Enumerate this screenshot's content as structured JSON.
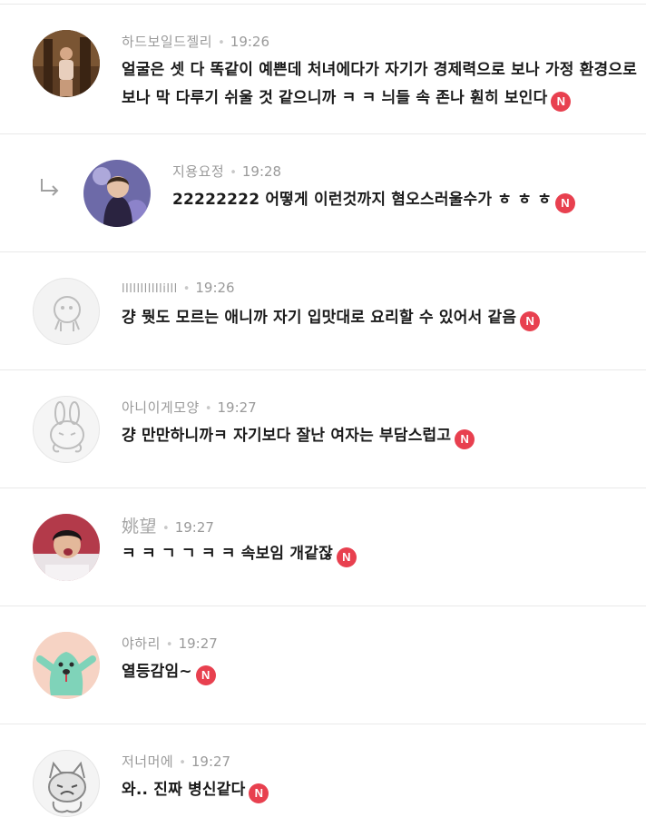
{
  "comments": [
    {
      "nickname": "하드보일드젤리",
      "time": "19:26",
      "text_line1": "얼굴은 셋 다 똑같이 예쁜데 처녀에다가 자기가 경제력으로 보나 가정 환경으로",
      "text_line2": "보나 막 다루기 쉬울 것 같으니까 ㅋ ㅋ 늬들 속 존나 훤히 보인다",
      "badge": "N",
      "avatar": "photo-avatar"
    },
    {
      "nickname": "지용요정",
      "time": "19:28",
      "text_line1": "22222222 어떻게 이런것까지 혐오스러울수가 ㅎ ㅎ ㅎ",
      "badge": "N",
      "avatar": "photo-avatar",
      "is_reply": true
    },
    {
      "nickname": "lllllllllllilll",
      "time": "19:26",
      "text_line1": "걍 뭣도 모르는 애니까 자기 입맛대로 요리할 수 있어서 같음",
      "badge": "N",
      "avatar": "default-character-avatar"
    },
    {
      "nickname": "아니이게모양",
      "time": "19:27",
      "text_line1": "걍 만만하니까ㅋ 자기보다 잘난 여자는 부담스럽고",
      "badge": "N",
      "avatar": "rabbit-avatar"
    },
    {
      "nickname": "姚望",
      "time": "19:27",
      "text_line1": "ㅋ ㅋ ㄱ ㄱ ㅋ ㅋ 속보임 개같잖",
      "badge": "N",
      "avatar": "photo-avatar"
    },
    {
      "nickname": "야하리",
      "time": "19:27",
      "text_line1": "열등감임~",
      "badge": "N",
      "avatar": "mint-character-avatar"
    },
    {
      "nickname": "저너머에",
      "time": "19:27",
      "text_line1": "와.. 진짜 병신같다",
      "badge": "N",
      "avatar": "cat-drawing-avatar"
    }
  ],
  "colors": {
    "badge": "#e8404f",
    "meta": "#9a9a9a",
    "divider": "#e9e9e9",
    "text": "#1b1b1b"
  },
  "icons": {
    "reply": "reply-arrow-icon",
    "new": "new-badge-icon"
  }
}
